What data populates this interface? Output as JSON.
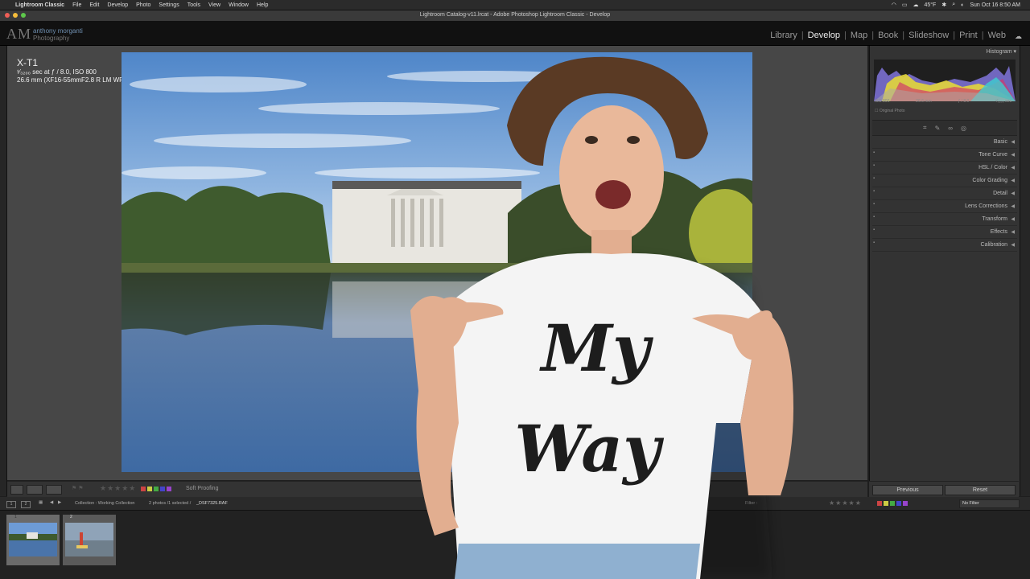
{
  "menubar": {
    "app": "Lightroom Classic",
    "items": [
      "File",
      "Edit",
      "Develop",
      "Photo",
      "Settings",
      "Tools",
      "View",
      "Window",
      "Help"
    ],
    "weather": "45°F",
    "datetime": "Sun Oct 16  8:50 AM"
  },
  "window": {
    "title": "Lightroom Catalog-v11.lrcat - Adobe Photoshop Lightroom Classic - Develop"
  },
  "identity": {
    "logo_initials": "AM",
    "logo_line1": "anthony morganti",
    "logo_line2": "Photography"
  },
  "modules": [
    "Library",
    "Develop",
    "Map",
    "Book",
    "Slideshow",
    "Print",
    "Web"
  ],
  "active_module": "Develop",
  "photo_info": {
    "camera": "X-T1",
    "exposure_line": "¹⁄₃₂₀₀ sec at ƒ / 8.0, ISO 800",
    "lens_line": "26.6 mm (XF16-55mmF2.8 R LM WR)"
  },
  "toolbar": {
    "soft_proofing": "Soft Proofing",
    "stars": "★★★★★"
  },
  "histogram": {
    "label": "Histogram",
    "iso": "ISO 800",
    "focal": "26.6 mm",
    "aperture": "ƒ / 8.0",
    "shutter": "¹⁄₃₂₀₀ sec",
    "original_photo": "Original Photo"
  },
  "panels": [
    "Basic",
    "Tone Curve",
    "HSL / Color",
    "Color Grading",
    "Detail",
    "Lens Corrections",
    "Transform",
    "Effects",
    "Calibration"
  ],
  "buttons": {
    "previous": "Previous",
    "reset": "Reset"
  },
  "filmstrip": {
    "source": "Collection : Working Collection",
    "count": "2 photos /1 selected /",
    "filename": "_DSF7325.RAF",
    "filter_label": "Filter :",
    "filter_value": "No Filter",
    "thumb_numbers": [
      "1",
      "2"
    ],
    "screen1": "1",
    "screen2": "2"
  },
  "overlay": {
    "shirt_line1": "My",
    "shirt_line2": "Way"
  },
  "colors": {
    "accent_blue": "#6f8fb0",
    "label_red": "#c44",
    "label_yellow": "#cc4",
    "label_green": "#4a4",
    "label_blue": "#44c",
    "label_purple": "#94c"
  }
}
